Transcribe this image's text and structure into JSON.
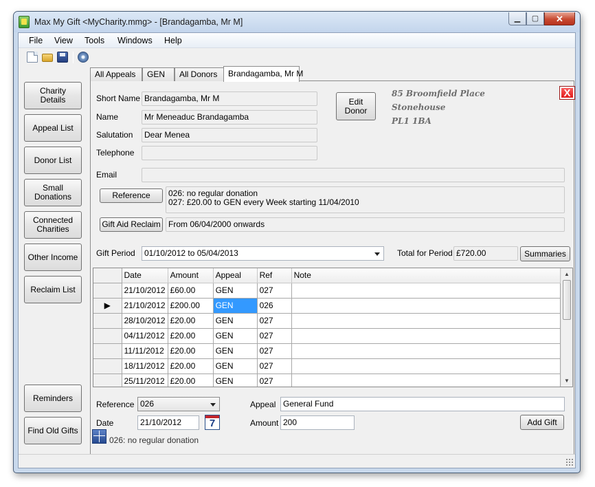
{
  "window": {
    "title": "Max My Gift <MyCharity.mmg>  - [Brandagamba, Mr M]"
  },
  "menu": [
    "File",
    "View",
    "Tools",
    "Windows",
    "Help"
  ],
  "sidebar": {
    "charity_details": "Charity Details",
    "appeal_list": "Appeal List",
    "donor_list": "Donor List",
    "small_donations": "Small\nDonations",
    "connected_charities": "Connected\nCharities",
    "other_income": "Other Income",
    "reclaim_list": "Reclaim List",
    "reminders": "Reminders",
    "find_old_gifts": "Find Old Gifts"
  },
  "tabs": [
    "All Appeals",
    "GEN",
    "All Donors",
    "Brandagamba, Mr M"
  ],
  "donor": {
    "short_name_label": "Short Name",
    "short_name": "Brandagamba, Mr M",
    "name_label": "Name",
    "name": "Mr Meneaduc Brandagamba",
    "salutation_label": "Salutation",
    "salutation": "Dear Menea",
    "telephone_label": "Telephone",
    "telephone": "",
    "email_label": "Email",
    "email": "",
    "edit_button": "Edit\nDonor",
    "address": [
      "85 Broomfield Place",
      "Stonehouse",
      "PL1 1BA"
    ],
    "reference_button": "Reference",
    "reference_text": [
      "026: no regular donation",
      "027: £20.00 to GEN every Week starting 11/04/2010"
    ],
    "gift_aid_button": "Gift Aid Reclaim",
    "gift_aid_text": "From 06/04/2000 onwards"
  },
  "gift_period": {
    "label": "Gift Period",
    "value": "01/10/2012 to 05/04/2013",
    "total_label": "Total for Period",
    "total": "£720.00",
    "summaries_button": "Summaries"
  },
  "grid": {
    "columns": [
      "Date",
      "Amount",
      "Appeal",
      "Ref",
      "Note"
    ],
    "current_row_marker": "▶",
    "rows": [
      [
        "21/10/2012",
        "£60.00",
        "GEN",
        "027",
        ""
      ],
      [
        "21/10/2012",
        "£200.00",
        "GEN",
        "026",
        ""
      ],
      [
        "28/10/2012",
        "£20.00",
        "GEN",
        "027",
        ""
      ],
      [
        "04/11/2012",
        "£20.00",
        "GEN",
        "027",
        ""
      ],
      [
        "11/11/2012",
        "£20.00",
        "GEN",
        "027",
        ""
      ],
      [
        "18/11/2012",
        "£20.00",
        "GEN",
        "027",
        ""
      ],
      [
        "25/11/2012",
        "£20.00",
        "GEN",
        "027",
        ""
      ]
    ]
  },
  "entry": {
    "reference_label": "Reference",
    "reference": "026",
    "appeal_label": "Appeal",
    "appeal": "General Fund",
    "date_label": "Date",
    "date": "21/10/2012",
    "calendar_digit": "7",
    "amount_label": "Amount",
    "amount": "200",
    "add_gift_button": "Add Gift",
    "note": "026: no regular donation"
  },
  "icons": {
    "close_x": "X",
    "minimize": "▁",
    "maximize": "▢",
    "close": "✕",
    "scroll_up": "▲",
    "scroll_down": "▼"
  }
}
